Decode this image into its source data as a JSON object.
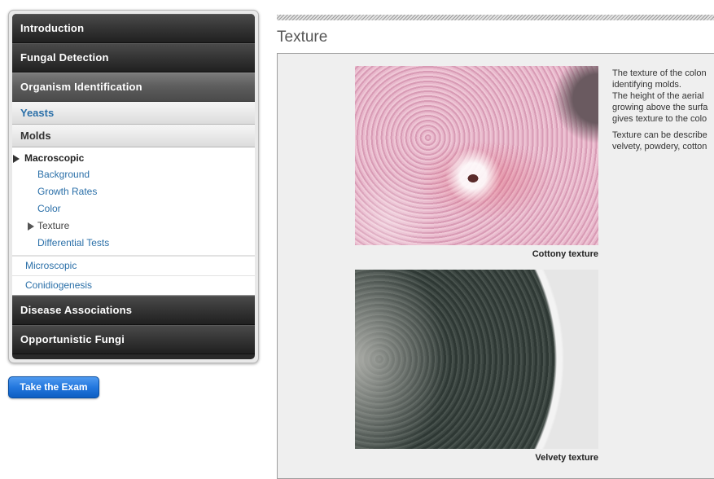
{
  "sidebar": {
    "top_items": [
      "Introduction",
      "Fungal Detection"
    ],
    "active_item": "Organism Identification",
    "sub_items": [
      "Yeasts",
      "Molds"
    ],
    "macro_title": "Macroscopic",
    "macro_items": [
      "Background",
      "Growth Rates",
      "Color",
      "Texture",
      "Differential Tests"
    ],
    "level2_items": [
      "Microscopic",
      "Conidiogenesis"
    ],
    "bottom_items": [
      "Disease Associations",
      "Opportunistic Fungi"
    ]
  },
  "exam_button": "Take the Exam",
  "page": {
    "title": "Texture",
    "paragraph1": [
      "The texture of the colon",
      "identifying molds.",
      "The height of the aerial",
      "growing above the surfa",
      "gives texture to the colo"
    ],
    "paragraph2": [
      "Texture can be describe",
      "velvety, powdery, cotton"
    ],
    "captions": [
      "Cottony texture",
      "Velvety texture"
    ]
  },
  "colors": {
    "link": "#2a6fa8",
    "nav_dark": "#2a2a2a",
    "nav_active": "#5e5e5e",
    "exam_button": "#2377de"
  }
}
